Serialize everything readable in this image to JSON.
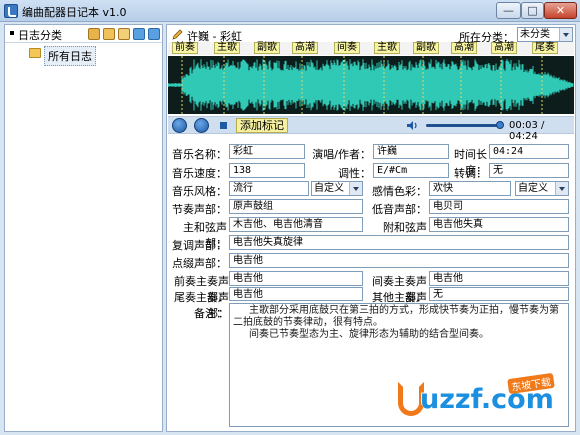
{
  "window": {
    "title": "编曲配器日记本 v1.0",
    "min_label": "—",
    "max_label": "□",
    "close_label": "✕"
  },
  "left_panel": {
    "title": "日志分类",
    "tree_items": [
      "所有日志"
    ]
  },
  "header": {
    "song_title": "许巍 - 彩虹",
    "category_label": "所在分类：",
    "category_value": "未分类"
  },
  "markers": [
    "前奏",
    "主歌",
    "副歌",
    "高潮",
    "间奏",
    "主歌",
    "副歌",
    "高潮",
    "高潮",
    "尾奏"
  ],
  "transport": {
    "add_mark_label": "添加标记",
    "time": "00:03 / 04:24",
    "progress_fraction": 0.0114
  },
  "form": {
    "music_name_label": "音乐名称：",
    "music_name": "彩虹",
    "artist_label": "演唱/作者：",
    "artist": "许巍",
    "duration_label": "时间长度：",
    "duration": "04:24",
    "tempo_label": "音乐速度：",
    "tempo": "138",
    "key_label": "调性：",
    "key": "E/#Cm",
    "modulation_label": "转调：",
    "modulation": "无",
    "style_label": "音乐风格：",
    "style": "流行",
    "style_custom": "自定义",
    "emotion_label": "感情色彩：",
    "emotion": "欢快",
    "emotion_custom": "自定义",
    "rhythm_label": "节奏声部：",
    "rhythm": "原声鼓组",
    "bass_label": "低音声部：",
    "bass": "电贝司",
    "harmony_label": "主和弦声部：",
    "harmony": "木吉他、电吉他清音",
    "sub_harmony_label": "附和弦声部：",
    "sub_harmony": "电吉他失真",
    "counter_label": "复调声部：",
    "counter": "电吉他失真旋律",
    "accent_label": "点缀声部：",
    "accent": "电吉他",
    "intro_lead_label": "前奏主奏声部：",
    "intro_lead": "电吉他",
    "interlude_lead_label": "间奏主奏声部：",
    "interlude_lead": "电吉他",
    "outro_lead_label": "尾奏主奏声部：",
    "outro_lead": "电吉他",
    "other_lead_label": "其他主奏声部：",
    "other_lead": "无",
    "notes_label": "备注：",
    "notes_line1": "主歌部分采用底鼓只在第三拍的方式，形成快节奏为正拍，慢节奏为第二拍底鼓的节奏律动，很有特点。",
    "notes_line2": "间奏已节奏型态为主、旋律形态为辅助的结合型间奏。"
  },
  "watermark": {
    "brand": "uzzf.com",
    "tag": "东坡下载"
  },
  "colors": {
    "wave": "#2fc9b6",
    "wave_bg": "#0d1d1b",
    "marker_bg": "#f7f5a3",
    "panel_bg": "#d7e4f2"
  }
}
